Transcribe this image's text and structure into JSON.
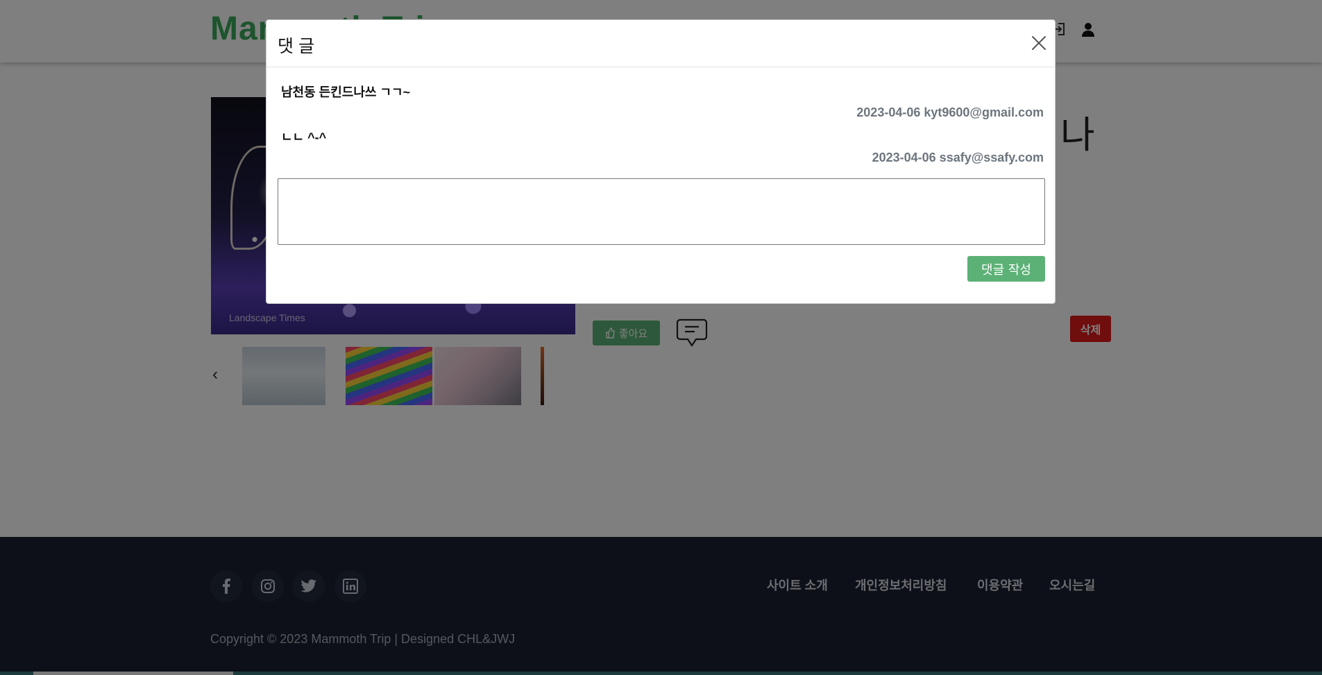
{
  "header": {
    "brand": "Mammoth Trip",
    "icons": [
      "login-icon",
      "user-icon"
    ]
  },
  "post": {
    "photo_caption": "Landscape Times",
    "title_fragment": "나",
    "like_label": "좋아요",
    "delete_label": "삭제",
    "carousel_prev_glyph": "‹"
  },
  "modal": {
    "title": "댓 글",
    "comments": [
      {
        "text": "남천동 든킨드나쓰 ㄱㄱ~",
        "meta": "2023-04-06 kyt9600@gmail.com"
      },
      {
        "text": "ㄴㄴ ^-^",
        "meta": "2023-04-06 ssafy@ssafy.com"
      }
    ],
    "input_value": "",
    "submit_label": "댓글 작성"
  },
  "footer": {
    "social": [
      "facebook-icon",
      "instagram-icon",
      "twitter-icon",
      "linkedin-icon"
    ],
    "links": [
      "사이트 소개",
      "개인정보처리방침",
      "이용약관",
      "오시는길"
    ],
    "copyright": "Copyright © 2023 Mammoth Trip | Designed CHL&JWJ"
  },
  "colors": {
    "brand_green": "#3aa85a",
    "button_green": "#5cb176",
    "delete_red": "#e11b1b",
    "footer_bg": "#1a2130"
  }
}
